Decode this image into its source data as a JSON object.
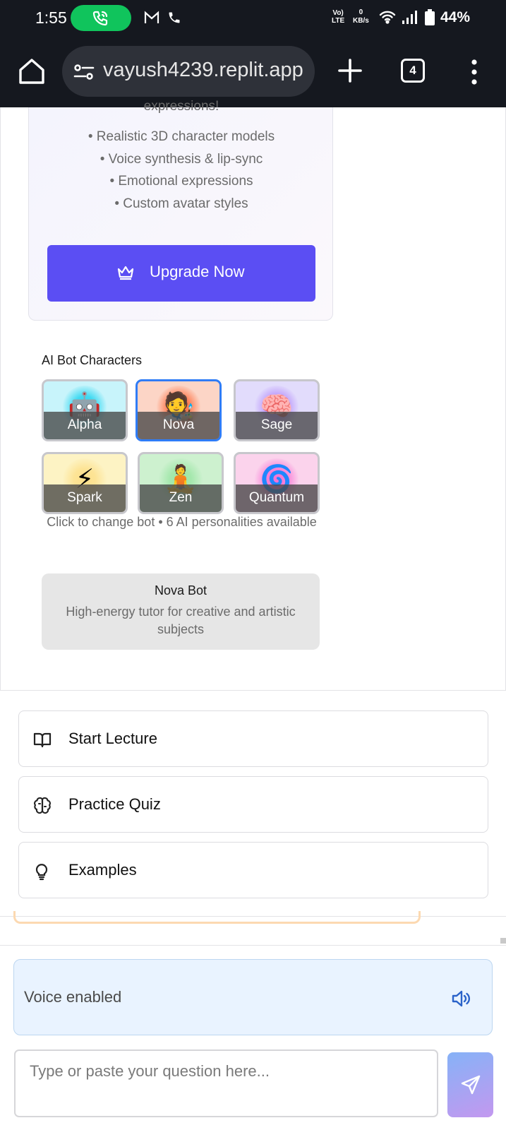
{
  "status_bar": {
    "time": "1:55",
    "network_line1": "Vo)",
    "network_line2": "LTE",
    "speed_value": "0",
    "speed_unit": "KB/s",
    "battery": "44%"
  },
  "browser": {
    "url": "vayush4239.replit.app",
    "tab_count": "4"
  },
  "upgrade_card": {
    "clipped_heading": "expressions!",
    "features": [
      "• Realistic 3D character models",
      "• Voice synthesis & lip-sync",
      "• Emotional expressions",
      "• Custom avatar styles"
    ],
    "button_label": "Upgrade Now"
  },
  "bots": {
    "title": "AI Bot Characters",
    "items": [
      {
        "name": "Alpha",
        "emoji": "🤖",
        "bg": "#c8f4fb",
        "glow": "#20d4f0"
      },
      {
        "name": "Nova",
        "emoji": "🧑‍🎨",
        "bg": "#fcd5c6",
        "glow": "#ff6a3a"
      },
      {
        "name": "Sage",
        "emoji": "🧠",
        "bg": "#e2dcfc",
        "glow": "#b48cfa"
      },
      {
        "name": "Spark",
        "emoji": "⚡",
        "bg": "#fdf3c4",
        "glow": "#fde08a"
      },
      {
        "name": "Zen",
        "emoji": "🧘",
        "bg": "#cdf1cf",
        "glow": "#9be6a5"
      },
      {
        "name": "Quantum",
        "emoji": "🌀",
        "bg": "#fbd3ec",
        "glow": "#f76fd3"
      }
    ],
    "selected": "Nova",
    "note": "Click to change bot • 6 AI personalities available",
    "detail_name": "Nova Bot",
    "detail_text": "High-energy tutor for creative and artistic subjects"
  },
  "actions": [
    {
      "label": "Start Lecture",
      "icon": "book-open-icon"
    },
    {
      "label": "Practice Quiz",
      "icon": "brain-icon"
    },
    {
      "label": "Examples",
      "icon": "lightbulb-icon"
    }
  ],
  "voice": {
    "label": "Voice enabled",
    "icon": "speaker-icon"
  },
  "question": {
    "placeholder": "Type or paste your question here...",
    "value": ""
  },
  "colors": {
    "accent": "#5b4ef3",
    "selected_border": "#2f7cf6",
    "voice_bg": "#e9f3ff"
  }
}
